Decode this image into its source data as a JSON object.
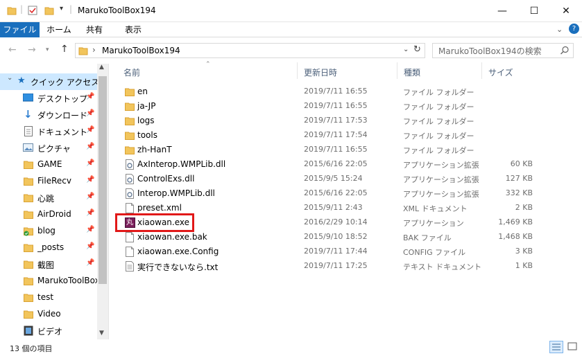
{
  "window": {
    "title": "MarukoToolBox194",
    "minimize_glyph": "—",
    "maximize_glyph": "☐",
    "close_glyph": "✕"
  },
  "ribbon": {
    "tabs": [
      "ファイル",
      "ホーム",
      "共有",
      "表示"
    ],
    "expand_glyph": "⌄",
    "help_glyph": "?"
  },
  "address": {
    "path": "MarukoToolBox194",
    "separator": "›",
    "search_placeholder": "MarukoToolBox194の検索"
  },
  "nav": {
    "quick_access": "クイック アクセス",
    "items": [
      {
        "label": "デスクトップ",
        "icon": "desktop-icon",
        "pinned": true
      },
      {
        "label": "ダウンロード",
        "icon": "download-icon",
        "pinned": true
      },
      {
        "label": "ドキュメント",
        "icon": "document-icon",
        "pinned": true
      },
      {
        "label": "ピクチャ",
        "icon": "picture-icon",
        "pinned": true
      },
      {
        "label": "GAME",
        "icon": "folder-icon",
        "pinned": true
      },
      {
        "label": "FileRecv",
        "icon": "folder-icon",
        "pinned": true
      },
      {
        "label": "心跳",
        "icon": "folder-icon",
        "pinned": true
      },
      {
        "label": "AirDroid",
        "icon": "folder-icon",
        "pinned": true
      },
      {
        "label": "blog",
        "icon": "folder-sync-icon",
        "pinned": true
      },
      {
        "label": "_posts",
        "icon": "folder-icon",
        "pinned": true
      },
      {
        "label": "截图",
        "icon": "folder-icon",
        "pinned": true
      },
      {
        "label": "MarukoToolBox",
        "icon": "folder-icon",
        "pinned": false
      },
      {
        "label": "test",
        "icon": "folder-icon",
        "pinned": false
      },
      {
        "label": "Video",
        "icon": "folder-icon",
        "pinned": false
      },
      {
        "label": "ビデオ",
        "icon": "video-icon",
        "pinned": false
      }
    ]
  },
  "columns": {
    "name": "名前",
    "modified": "更新日時",
    "type": "種類",
    "size": "サイズ"
  },
  "files": [
    {
      "name": "en",
      "date": "2019/7/11 16:55",
      "type": "ファイル フォルダー",
      "size": "",
      "icon": "folder-icon"
    },
    {
      "name": "ja-JP",
      "date": "2019/7/11 16:55",
      "type": "ファイル フォルダー",
      "size": "",
      "icon": "folder-icon"
    },
    {
      "name": "logs",
      "date": "2019/7/11 17:53",
      "type": "ファイル フォルダー",
      "size": "",
      "icon": "folder-icon"
    },
    {
      "name": "tools",
      "date": "2019/7/11 17:54",
      "type": "ファイル フォルダー",
      "size": "",
      "icon": "folder-icon"
    },
    {
      "name": "zh-HanT",
      "date": "2019/7/11 16:55",
      "type": "ファイル フォルダー",
      "size": "",
      "icon": "folder-icon"
    },
    {
      "name": "AxInterop.WMPLib.dll",
      "date": "2015/6/16 22:05",
      "type": "アプリケーション拡張",
      "size": "60 KB",
      "icon": "dll-icon"
    },
    {
      "name": "ControlExs.dll",
      "date": "2015/9/5 15:24",
      "type": "アプリケーション拡張",
      "size": "127 KB",
      "icon": "dll-icon"
    },
    {
      "name": "Interop.WMPLib.dll",
      "date": "2015/6/16 22:05",
      "type": "アプリケーション拡張",
      "size": "332 KB",
      "icon": "dll-icon"
    },
    {
      "name": "preset.xml",
      "date": "2015/9/11 2:43",
      "type": "XML ドキュメント",
      "size": "2 KB",
      "icon": "file-icon"
    },
    {
      "name": "xiaowan.exe",
      "date": "2016/2/29 10:14",
      "type": "アプリケーション",
      "size": "1,469 KB",
      "icon": "app-icon",
      "icon_text": "丸"
    },
    {
      "name": "xiaowan.exe.bak",
      "date": "2015/9/10 18:52",
      "type": "BAK ファイル",
      "size": "1,468 KB",
      "icon": "file-icon"
    },
    {
      "name": "xiaowan.exe.Config",
      "date": "2019/7/11 17:44",
      "type": "CONFIG ファイル",
      "size": "3 KB",
      "icon": "file-icon"
    },
    {
      "name": "実行できないなら.txt",
      "date": "2019/7/11 17:25",
      "type": "テキスト ドキュメント",
      "size": "1 KB",
      "icon": "text-file-icon"
    }
  ],
  "status": {
    "item_count": "13 個の項目"
  },
  "colors": {
    "accent": "#1a6fbd",
    "folder": "#f2c55c",
    "highlight_border": "#e11818",
    "selected_nav": "#cde8ff"
  }
}
